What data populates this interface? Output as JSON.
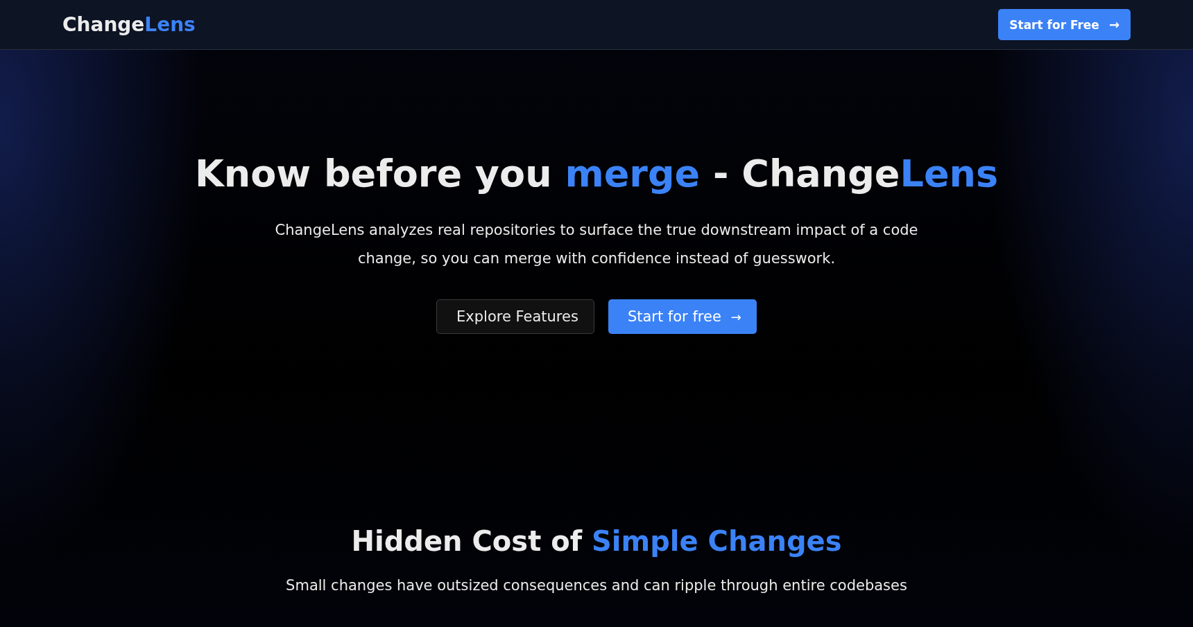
{
  "nav": {
    "logo": [
      {
        "text": "Change",
        "accent": false
      },
      {
        "text": "Lens",
        "accent": true
      }
    ],
    "cta": {
      "label": "Start for Free",
      "icon": "→"
    }
  },
  "hero": {
    "title": [
      {
        "text": "Know before you ",
        "accent": false
      },
      {
        "text": "merge",
        "accent": true
      },
      {
        "text": " - Change",
        "accent": false
      },
      {
        "text": "Lens",
        "accent": true
      }
    ],
    "description": "ChangeLens analyzes real repositories to surface the true downstream impact of a code change, so you can merge with confidence instead of guesswork.",
    "buttons": [
      {
        "label": "Explore Features",
        "kind": "secondary"
      },
      {
        "label": "Start for free",
        "kind": "primary",
        "icon": "→"
      }
    ]
  },
  "section": {
    "title": [
      {
        "text": "Hidden Cost of ",
        "accent": false
      },
      {
        "text": "Simple Changes",
        "accent": true
      }
    ],
    "subtitle": "Small changes have outsized consequences and can ripple through entire codebases"
  }
}
